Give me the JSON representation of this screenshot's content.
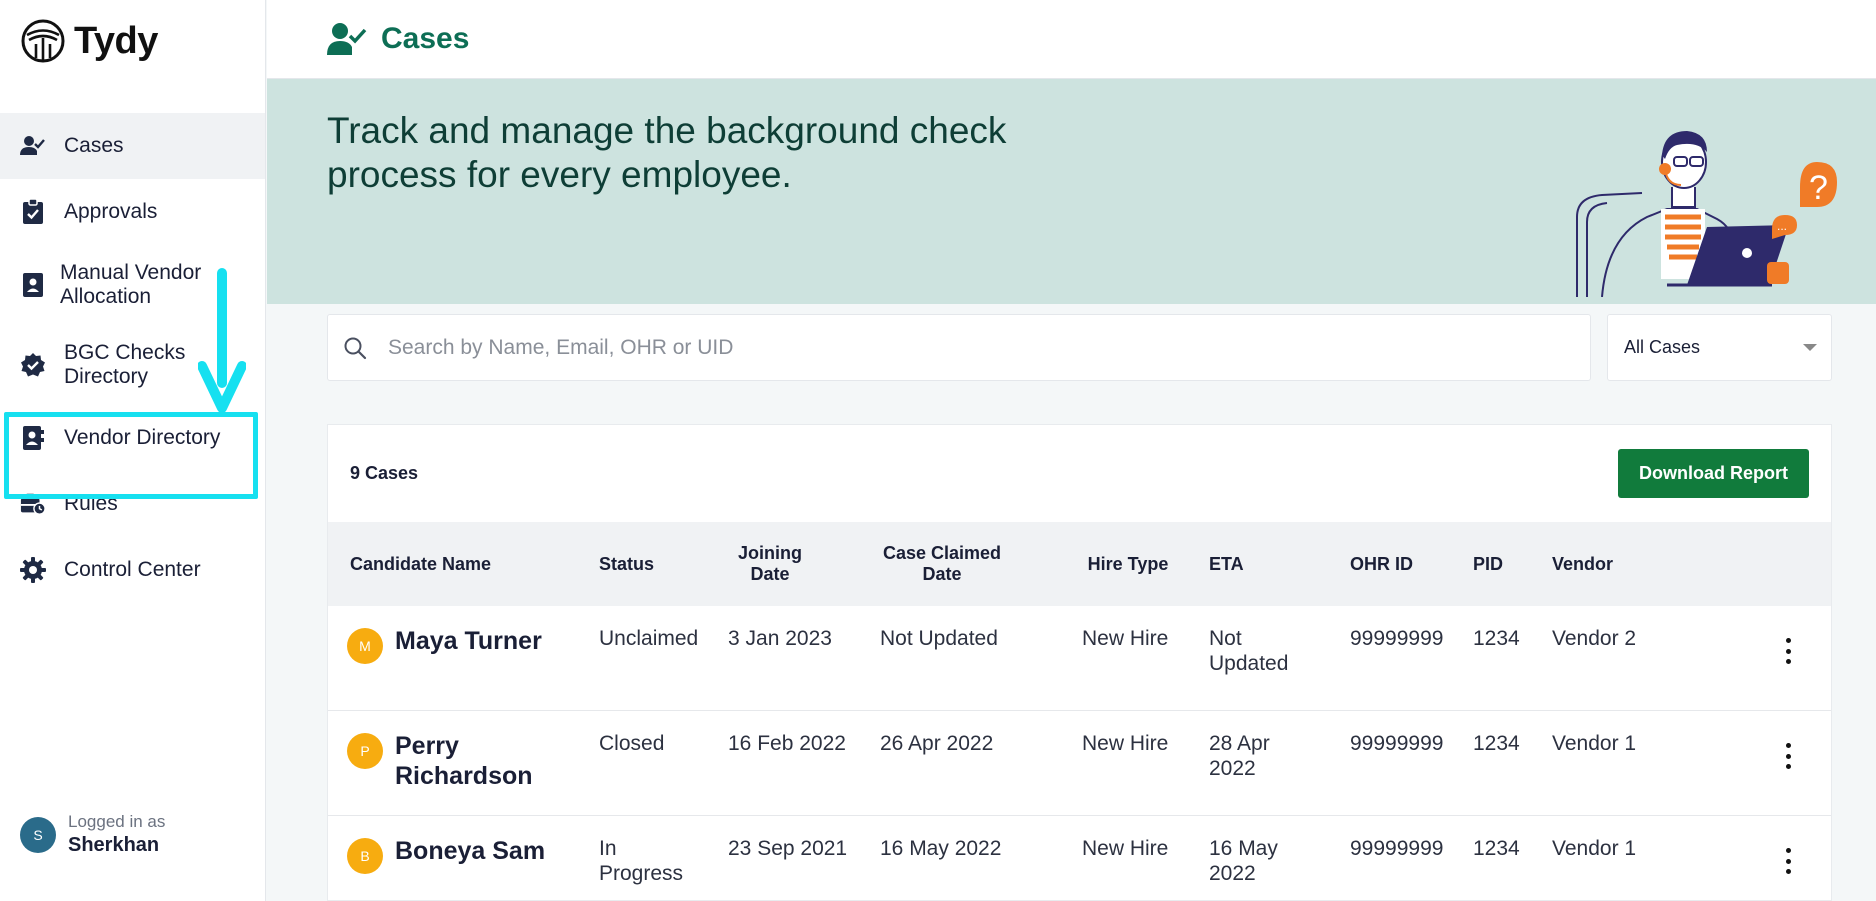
{
  "app": {
    "name": "Tydy"
  },
  "sidebar": {
    "items": [
      {
        "label": "Cases"
      },
      {
        "label": "Approvals"
      },
      {
        "label": "Manual Vendor Allocation"
      },
      {
        "label": "BGC Checks Directory"
      },
      {
        "label": "Vendor Directory"
      },
      {
        "label": "Rules"
      },
      {
        "label": "Control Center"
      }
    ],
    "user": {
      "initial": "S",
      "logged_in_label": "Logged in as",
      "name": "Sherkhan"
    }
  },
  "header": {
    "title": "Cases"
  },
  "banner": {
    "text": "Track and manage the background check process for every employee."
  },
  "search": {
    "placeholder": "Search by Name, Email, OHR or UID",
    "value": ""
  },
  "filter": {
    "selected": "All Cases"
  },
  "table": {
    "count_label": "9 Cases",
    "download_label": "Download Report",
    "columns": {
      "name": "Candidate Name",
      "status": "Status",
      "joining": "Joining Date",
      "claimed": "Case Claimed Date",
      "hire": "Hire Type",
      "eta": "ETA",
      "ohr": "OHR ID",
      "pid": "PID",
      "vendor": "Vendor"
    },
    "rows": [
      {
        "initial": "M",
        "name": "Maya Turner",
        "status": "Unclaimed",
        "joining": "3 Jan 2023",
        "claimed": "Not Updated",
        "hire": "New Hire",
        "eta": "Not Updated",
        "ohr": "99999999",
        "pid": "1234",
        "vendor": "Vendor 2"
      },
      {
        "initial": "P",
        "name": "Perry Richardson",
        "status": "Closed",
        "joining": "16 Feb 2022",
        "claimed": "26 Apr 2022",
        "hire": "New Hire",
        "eta": "28 Apr 2022",
        "ohr": "99999999",
        "pid": "1234",
        "vendor": "Vendor 1"
      },
      {
        "initial": "B",
        "name": "Boneya Sam",
        "status": "In Progress",
        "joining": "23 Sep 2021",
        "claimed": "16 May 2022",
        "hire": "New Hire",
        "eta": "16 May 2022",
        "ohr": "99999999",
        "pid": "1234",
        "vendor": "Vendor 1"
      }
    ]
  },
  "colors": {
    "brand": "#0d6e55",
    "button": "#117b3c",
    "banner": "#cde3df",
    "avatar": "#f7ac10",
    "highlight": "#16e0f0"
  }
}
